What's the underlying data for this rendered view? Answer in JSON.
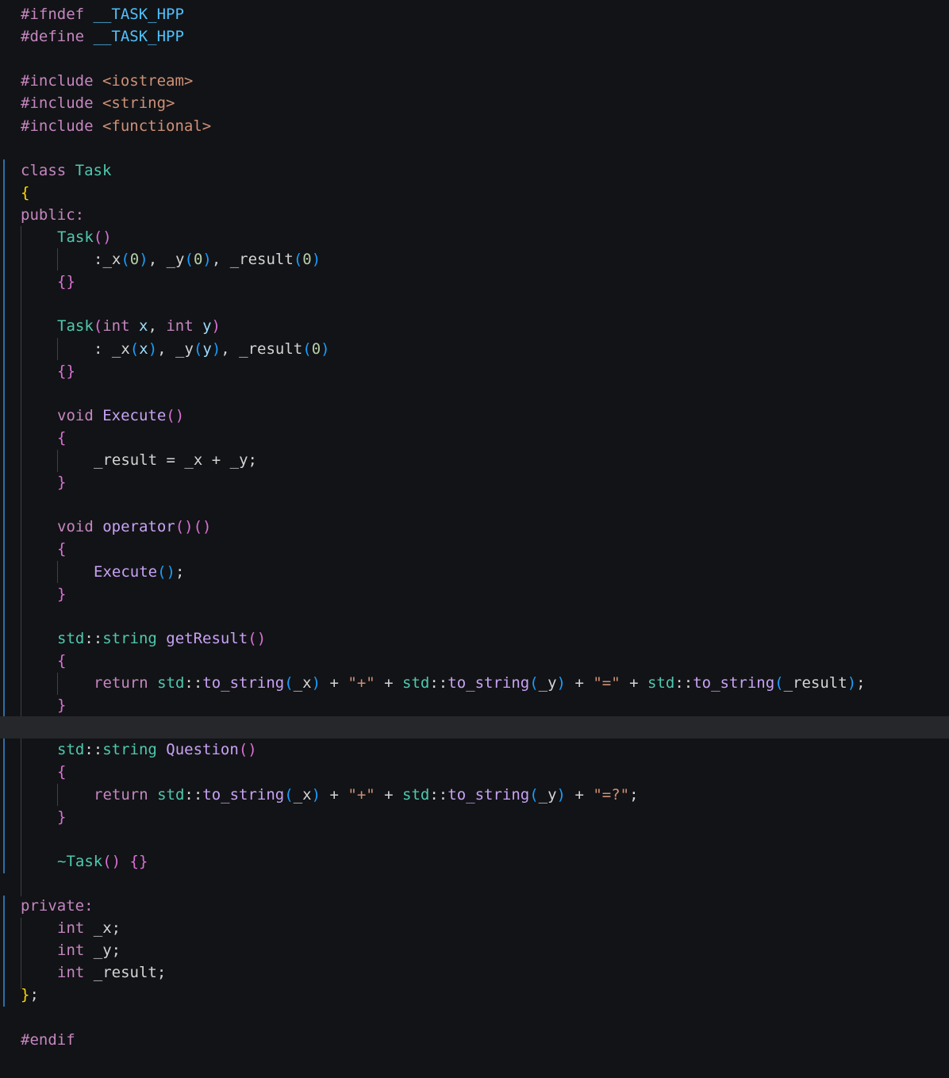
{
  "colors": {
    "background": "#121316",
    "current_line": "#26272a",
    "scope_bar": "#2c6faa"
  },
  "code": {
    "l1": [
      [
        "#ifndef ",
        "tok-pre"
      ],
      [
        "__TASK_HPP",
        "tok-mac"
      ]
    ],
    "l2": [
      [
        "#define ",
        "tok-pre"
      ],
      [
        "__TASK_HPP",
        "tok-mac"
      ]
    ],
    "l3": [],
    "l4": [
      [
        "#include ",
        "tok-pre"
      ],
      [
        "<iostream>",
        "tok-inc"
      ]
    ],
    "l5": [
      [
        "#include ",
        "tok-pre"
      ],
      [
        "<string>",
        "tok-inc"
      ]
    ],
    "l6": [
      [
        "#include ",
        "tok-pre"
      ],
      [
        "<functional>",
        "tok-inc"
      ]
    ],
    "l7": [],
    "l8": [
      [
        "class ",
        "tok-kw"
      ],
      [
        "Task",
        "tok-type"
      ]
    ],
    "l9": [
      [
        "{",
        "tok-b1"
      ]
    ],
    "l10": [
      [
        "public:",
        "tok-kw"
      ]
    ],
    "l11": [
      [
        "Task",
        "tok-type"
      ],
      [
        "()",
        "tok-b2"
      ]
    ],
    "l12": [
      [
        ":",
        "tok-txt"
      ],
      [
        "_x",
        "tok-mem"
      ],
      [
        "(",
        "tok-b3"
      ],
      [
        "0",
        "tok-num"
      ],
      [
        ")",
        "tok-b3"
      ],
      [
        ", ",
        "tok-txt"
      ],
      [
        "_y",
        "tok-mem"
      ],
      [
        "(",
        "tok-b3"
      ],
      [
        "0",
        "tok-num"
      ],
      [
        ")",
        "tok-b3"
      ],
      [
        ", ",
        "tok-txt"
      ],
      [
        "_result",
        "tok-mem"
      ],
      [
        "(",
        "tok-b3"
      ],
      [
        "0",
        "tok-num"
      ],
      [
        ")",
        "tok-b3"
      ]
    ],
    "l13": [
      [
        "{}",
        "tok-b2"
      ]
    ],
    "l14": [],
    "l15": [
      [
        "Task",
        "tok-type"
      ],
      [
        "(",
        "tok-b2"
      ],
      [
        "int ",
        "tok-kw2"
      ],
      [
        "x",
        "tok-var"
      ],
      [
        ", ",
        "tok-txt"
      ],
      [
        "int ",
        "tok-kw2"
      ],
      [
        "y",
        "tok-var"
      ],
      [
        ")",
        "tok-b2"
      ]
    ],
    "l16": [
      [
        ": ",
        "tok-txt"
      ],
      [
        "_x",
        "tok-mem"
      ],
      [
        "(",
        "tok-b3"
      ],
      [
        "x",
        "tok-var"
      ],
      [
        ")",
        "tok-b3"
      ],
      [
        ", ",
        "tok-txt"
      ],
      [
        "_y",
        "tok-mem"
      ],
      [
        "(",
        "tok-b3"
      ],
      [
        "y",
        "tok-var"
      ],
      [
        ")",
        "tok-b3"
      ],
      [
        ", ",
        "tok-txt"
      ],
      [
        "_result",
        "tok-mem"
      ],
      [
        "(",
        "tok-b3"
      ],
      [
        "0",
        "tok-num"
      ],
      [
        ")",
        "tok-b3"
      ]
    ],
    "l17": [
      [
        "{}",
        "tok-b2"
      ]
    ],
    "l18": [],
    "l19": [
      [
        "void ",
        "tok-kw2"
      ],
      [
        "Execute",
        "tok-fn2"
      ],
      [
        "()",
        "tok-b2"
      ]
    ],
    "l20": [
      [
        "{",
        "tok-b2"
      ]
    ],
    "l21": [
      [
        "_result",
        "tok-mem"
      ],
      [
        " = ",
        "tok-txt"
      ],
      [
        "_x",
        "tok-mem"
      ],
      [
        " + ",
        "tok-txt"
      ],
      [
        "_y",
        "tok-mem"
      ],
      [
        ";",
        "tok-txt"
      ]
    ],
    "l22": [
      [
        "}",
        "tok-b2"
      ]
    ],
    "l23": [],
    "l24": [
      [
        "void ",
        "tok-kw2"
      ],
      [
        "operator",
        "tok-fn2"
      ],
      [
        "()",
        "tok-b2"
      ],
      [
        "()",
        "tok-b2"
      ]
    ],
    "l25": [
      [
        "{",
        "tok-b2"
      ]
    ],
    "l26": [
      [
        "Execute",
        "tok-fn2"
      ],
      [
        "()",
        "tok-b3"
      ],
      [
        ";",
        "tok-txt"
      ]
    ],
    "l27": [
      [
        "}",
        "tok-b2"
      ]
    ],
    "l28": [],
    "l29": [
      [
        "std",
        "tok-ns"
      ],
      [
        "::",
        "tok-txt"
      ],
      [
        "string ",
        "tok-ns"
      ],
      [
        "getResult",
        "tok-fn2"
      ],
      [
        "()",
        "tok-b2"
      ]
    ],
    "l30": [
      [
        "{",
        "tok-b2"
      ]
    ],
    "l31": [
      [
        "return ",
        "tok-kw"
      ],
      [
        "std",
        "tok-ns"
      ],
      [
        "::",
        "tok-txt"
      ],
      [
        "to_string",
        "tok-fn2"
      ],
      [
        "(",
        "tok-b3"
      ],
      [
        "_x",
        "tok-mem"
      ],
      [
        ")",
        "tok-b3"
      ],
      [
        " + ",
        "tok-txt"
      ],
      [
        "\"+\"",
        "tok-str"
      ],
      [
        " + ",
        "tok-txt"
      ],
      [
        "std",
        "tok-ns"
      ],
      [
        "::",
        "tok-txt"
      ],
      [
        "to_string",
        "tok-fn2"
      ],
      [
        "(",
        "tok-b3"
      ],
      [
        "_y",
        "tok-mem"
      ],
      [
        ")",
        "tok-b3"
      ],
      [
        " + ",
        "tok-txt"
      ],
      [
        "\"=\"",
        "tok-str"
      ],
      [
        " + ",
        "tok-txt"
      ],
      [
        "std",
        "tok-ns"
      ],
      [
        "::",
        "tok-txt"
      ],
      [
        "to_string",
        "tok-fn2"
      ],
      [
        "(",
        "tok-b3"
      ],
      [
        "_result",
        "tok-mem"
      ],
      [
        ")",
        "tok-b3"
      ],
      [
        ";",
        "tok-txt"
      ]
    ],
    "l32": [
      [
        "}",
        "tok-b2"
      ]
    ],
    "l33": [],
    "l34": [
      [
        "std",
        "tok-ns"
      ],
      [
        "::",
        "tok-txt"
      ],
      [
        "string ",
        "tok-ns"
      ],
      [
        "Question",
        "tok-fn2"
      ],
      [
        "()",
        "tok-b2"
      ]
    ],
    "l35": [
      [
        "{",
        "tok-b2"
      ]
    ],
    "l36": [
      [
        "return ",
        "tok-kw"
      ],
      [
        "std",
        "tok-ns"
      ],
      [
        "::",
        "tok-txt"
      ],
      [
        "to_string",
        "tok-fn2"
      ],
      [
        "(",
        "tok-b3"
      ],
      [
        "_x",
        "tok-mem"
      ],
      [
        ")",
        "tok-b3"
      ],
      [
        " + ",
        "tok-txt"
      ],
      [
        "\"+\"",
        "tok-str"
      ],
      [
        " + ",
        "tok-txt"
      ],
      [
        "std",
        "tok-ns"
      ],
      [
        "::",
        "tok-txt"
      ],
      [
        "to_string",
        "tok-fn2"
      ],
      [
        "(",
        "tok-b3"
      ],
      [
        "_y",
        "tok-mem"
      ],
      [
        ")",
        "tok-b3"
      ],
      [
        " + ",
        "tok-txt"
      ],
      [
        "\"=?\"",
        "tok-str"
      ],
      [
        ";",
        "tok-txt"
      ]
    ],
    "l37": [
      [
        "}",
        "tok-b2"
      ]
    ],
    "l38": [],
    "l39": [
      [
        "~Task",
        "tok-type"
      ],
      [
        "()",
        "tok-b2"
      ],
      [
        " ",
        "tok-txt"
      ],
      [
        "{}",
        "tok-b2"
      ]
    ],
    "l40": [],
    "l41": [
      [
        "private:",
        "tok-kw"
      ]
    ],
    "l42": [
      [
        "int ",
        "tok-kw2"
      ],
      [
        "_x",
        "tok-mem"
      ],
      [
        ";",
        "tok-txt"
      ]
    ],
    "l43": [
      [
        "int ",
        "tok-kw2"
      ],
      [
        "_y",
        "tok-mem"
      ],
      [
        ";",
        "tok-txt"
      ]
    ],
    "l44": [
      [
        "int ",
        "tok-kw2"
      ],
      [
        "_result",
        "tok-mem"
      ],
      [
        ";",
        "tok-txt"
      ]
    ],
    "l45": [
      [
        "}",
        "tok-b1"
      ],
      [
        ";",
        "tok-txt"
      ]
    ],
    "l46": [],
    "l47": [
      [
        "#endif",
        "tok-pre"
      ]
    ]
  }
}
